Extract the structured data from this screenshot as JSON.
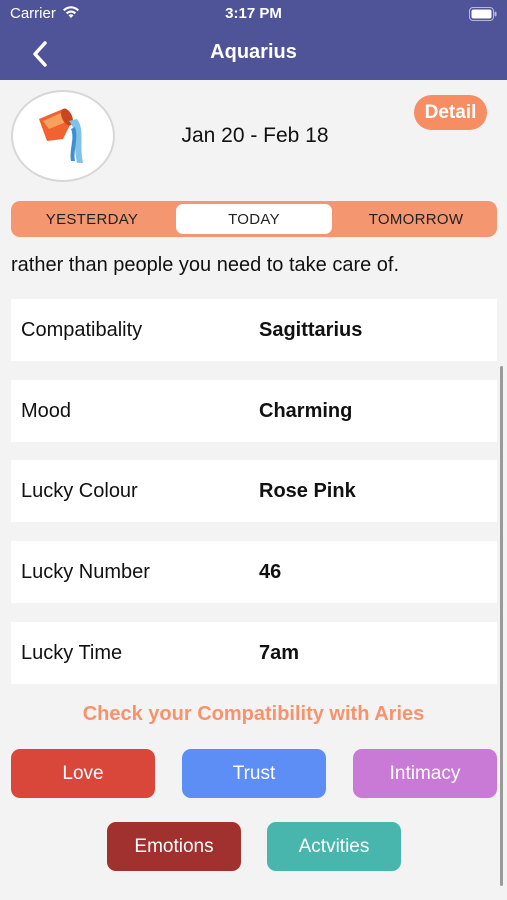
{
  "status_bar": {
    "carrier": "Carrier",
    "time": "3:17 PM"
  },
  "nav": {
    "title": "Aquarius"
  },
  "sign": {
    "date_range": "Jan 20 - Feb 18",
    "detail_label": "Detail",
    "icon": "aquarius-water-jug-icon"
  },
  "tabs": {
    "yesterday": "YESTERDAY",
    "today": "TODAY",
    "tomorrow": "TOMORROW",
    "selected": "TODAY"
  },
  "horoscope": {
    "visible_text": "rather than people you need to take care of."
  },
  "info_rows": [
    {
      "label": "Compatibality",
      "value": "Sagittarius"
    },
    {
      "label": "Mood",
      "value": "Charming"
    },
    {
      "label": "Lucky Colour",
      "value": "Rose Pink"
    },
    {
      "label": "Lucky Number",
      "value": "46"
    },
    {
      "label": "Lucky Time",
      "value": "7am"
    }
  ],
  "compatibility": {
    "heading": "Check your Compatibility with Aries",
    "buttons": {
      "love": "Love",
      "trust": "Trust",
      "intimacy": "Intimacy",
      "emotions": "Emotions",
      "activities": "Actvities"
    }
  },
  "colors": {
    "nav_bg": "#4f5397",
    "accent_orange": "#f68d63",
    "love": "#d9473b",
    "trust": "#5c8ef6",
    "intimacy": "#c97ad6",
    "emotions": "#a1312f",
    "activities": "#48b6ad"
  }
}
